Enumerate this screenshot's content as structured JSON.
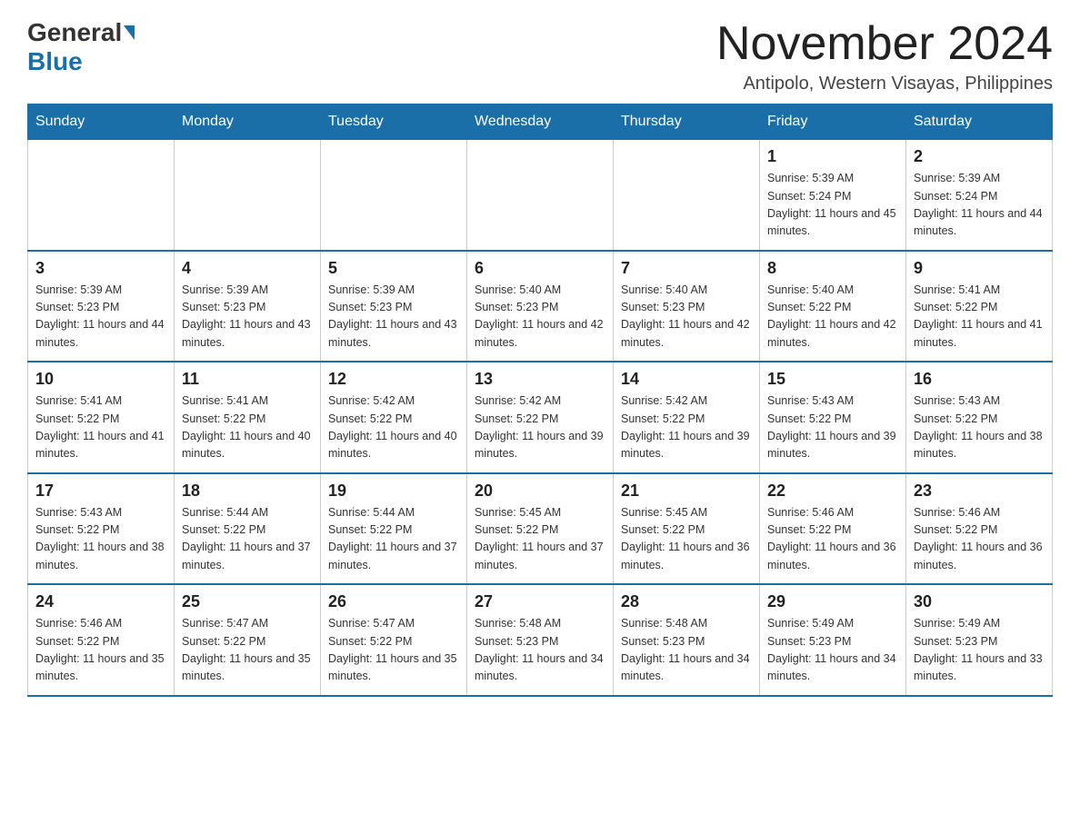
{
  "logo": {
    "general": "General",
    "blue": "Blue"
  },
  "header": {
    "title": "November 2024",
    "location": "Antipolo, Western Visayas, Philippines"
  },
  "days_of_week": [
    "Sunday",
    "Monday",
    "Tuesday",
    "Wednesday",
    "Thursday",
    "Friday",
    "Saturday"
  ],
  "weeks": [
    [
      {
        "day": "",
        "info": ""
      },
      {
        "day": "",
        "info": ""
      },
      {
        "day": "",
        "info": ""
      },
      {
        "day": "",
        "info": ""
      },
      {
        "day": "",
        "info": ""
      },
      {
        "day": "1",
        "info": "Sunrise: 5:39 AM\nSunset: 5:24 PM\nDaylight: 11 hours and 45 minutes."
      },
      {
        "day": "2",
        "info": "Sunrise: 5:39 AM\nSunset: 5:24 PM\nDaylight: 11 hours and 44 minutes."
      }
    ],
    [
      {
        "day": "3",
        "info": "Sunrise: 5:39 AM\nSunset: 5:23 PM\nDaylight: 11 hours and 44 minutes."
      },
      {
        "day": "4",
        "info": "Sunrise: 5:39 AM\nSunset: 5:23 PM\nDaylight: 11 hours and 43 minutes."
      },
      {
        "day": "5",
        "info": "Sunrise: 5:39 AM\nSunset: 5:23 PM\nDaylight: 11 hours and 43 minutes."
      },
      {
        "day": "6",
        "info": "Sunrise: 5:40 AM\nSunset: 5:23 PM\nDaylight: 11 hours and 42 minutes."
      },
      {
        "day": "7",
        "info": "Sunrise: 5:40 AM\nSunset: 5:23 PM\nDaylight: 11 hours and 42 minutes."
      },
      {
        "day": "8",
        "info": "Sunrise: 5:40 AM\nSunset: 5:22 PM\nDaylight: 11 hours and 42 minutes."
      },
      {
        "day": "9",
        "info": "Sunrise: 5:41 AM\nSunset: 5:22 PM\nDaylight: 11 hours and 41 minutes."
      }
    ],
    [
      {
        "day": "10",
        "info": "Sunrise: 5:41 AM\nSunset: 5:22 PM\nDaylight: 11 hours and 41 minutes."
      },
      {
        "day": "11",
        "info": "Sunrise: 5:41 AM\nSunset: 5:22 PM\nDaylight: 11 hours and 40 minutes."
      },
      {
        "day": "12",
        "info": "Sunrise: 5:42 AM\nSunset: 5:22 PM\nDaylight: 11 hours and 40 minutes."
      },
      {
        "day": "13",
        "info": "Sunrise: 5:42 AM\nSunset: 5:22 PM\nDaylight: 11 hours and 39 minutes."
      },
      {
        "day": "14",
        "info": "Sunrise: 5:42 AM\nSunset: 5:22 PM\nDaylight: 11 hours and 39 minutes."
      },
      {
        "day": "15",
        "info": "Sunrise: 5:43 AM\nSunset: 5:22 PM\nDaylight: 11 hours and 39 minutes."
      },
      {
        "day": "16",
        "info": "Sunrise: 5:43 AM\nSunset: 5:22 PM\nDaylight: 11 hours and 38 minutes."
      }
    ],
    [
      {
        "day": "17",
        "info": "Sunrise: 5:43 AM\nSunset: 5:22 PM\nDaylight: 11 hours and 38 minutes."
      },
      {
        "day": "18",
        "info": "Sunrise: 5:44 AM\nSunset: 5:22 PM\nDaylight: 11 hours and 37 minutes."
      },
      {
        "day": "19",
        "info": "Sunrise: 5:44 AM\nSunset: 5:22 PM\nDaylight: 11 hours and 37 minutes."
      },
      {
        "day": "20",
        "info": "Sunrise: 5:45 AM\nSunset: 5:22 PM\nDaylight: 11 hours and 37 minutes."
      },
      {
        "day": "21",
        "info": "Sunrise: 5:45 AM\nSunset: 5:22 PM\nDaylight: 11 hours and 36 minutes."
      },
      {
        "day": "22",
        "info": "Sunrise: 5:46 AM\nSunset: 5:22 PM\nDaylight: 11 hours and 36 minutes."
      },
      {
        "day": "23",
        "info": "Sunrise: 5:46 AM\nSunset: 5:22 PM\nDaylight: 11 hours and 36 minutes."
      }
    ],
    [
      {
        "day": "24",
        "info": "Sunrise: 5:46 AM\nSunset: 5:22 PM\nDaylight: 11 hours and 35 minutes."
      },
      {
        "day": "25",
        "info": "Sunrise: 5:47 AM\nSunset: 5:22 PM\nDaylight: 11 hours and 35 minutes."
      },
      {
        "day": "26",
        "info": "Sunrise: 5:47 AM\nSunset: 5:22 PM\nDaylight: 11 hours and 35 minutes."
      },
      {
        "day": "27",
        "info": "Sunrise: 5:48 AM\nSunset: 5:23 PM\nDaylight: 11 hours and 34 minutes."
      },
      {
        "day": "28",
        "info": "Sunrise: 5:48 AM\nSunset: 5:23 PM\nDaylight: 11 hours and 34 minutes."
      },
      {
        "day": "29",
        "info": "Sunrise: 5:49 AM\nSunset: 5:23 PM\nDaylight: 11 hours and 34 minutes."
      },
      {
        "day": "30",
        "info": "Sunrise: 5:49 AM\nSunset: 5:23 PM\nDaylight: 11 hours and 33 minutes."
      }
    ]
  ]
}
